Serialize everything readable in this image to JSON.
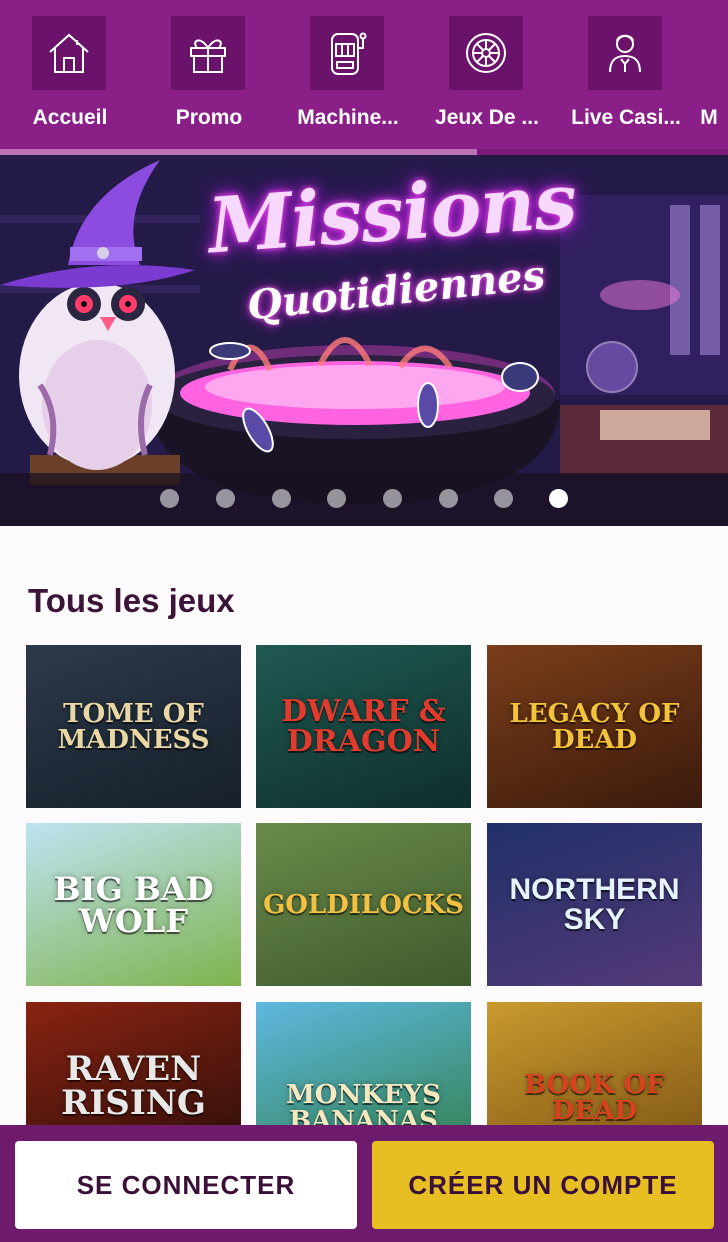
{
  "nav": {
    "items": [
      {
        "label": "Accueil",
        "icon": "home-icon"
      },
      {
        "label": "Promo",
        "icon": "gift-icon"
      },
      {
        "label": "Machine...",
        "icon": "slot-machine-icon"
      },
      {
        "label": "Jeux De ...",
        "icon": "roulette-icon"
      },
      {
        "label": "Live Casi...",
        "icon": "dealer-icon"
      },
      {
        "label": "M",
        "icon": ""
      }
    ]
  },
  "banner": {
    "title": "Missions",
    "subtitle": "Quotidiennes",
    "slide_count": 8,
    "active_slide": 8
  },
  "games_section": {
    "title": "Tous les jeux",
    "games": [
      {
        "title": "TOME OF MADNESS",
        "bg": "#2c3a4a",
        "bg2": "#171f2b",
        "fg": "#e9d8a6"
      },
      {
        "title": "DWARF & DRAGON",
        "bg": "#1f5a52",
        "bg2": "#0f2e2c",
        "fg": "#e23a2c"
      },
      {
        "title": "LEGACY OF DEAD",
        "bg": "#7a3e1a",
        "bg2": "#3b1a0c",
        "fg": "#f3c33a"
      },
      {
        "title": "BIG BAD WOLF",
        "bg": "#bfe3f2",
        "bg2": "#7fb34e",
        "fg": "#ffffff"
      },
      {
        "title": "GOLDILOCKS",
        "bg": "#6a8a4a",
        "bg2": "#3f5a2c",
        "fg": "#f2c042"
      },
      {
        "title": "NORTHERN SKY",
        "bg": "#20306a",
        "bg2": "#553a78",
        "fg": "#e6f4ff"
      },
      {
        "title": "RAVEN RISING",
        "bg": "#8a2312",
        "bg2": "#2a0e0a",
        "fg": "#e8e8e8"
      },
      {
        "title": "MONKEYS BANANAS",
        "bg": "#5fb8e0",
        "bg2": "#2f7f4a",
        "fg": "#f5e7c0"
      },
      {
        "title": "BOOK OF DEAD",
        "bg": "#c99a2e",
        "bg2": "#7a5214",
        "fg": "#d6421e"
      }
    ]
  },
  "actions": {
    "login": "SE CONNECTER",
    "signup": "CRÉER UN COMPTE"
  },
  "colors": {
    "nav_bg": "#8a1f87",
    "nav_tile": "#6b136a",
    "bottom_bar": "#6e1a6d",
    "signup_button": "#e8bf23",
    "title_text": "#3b1438"
  }
}
